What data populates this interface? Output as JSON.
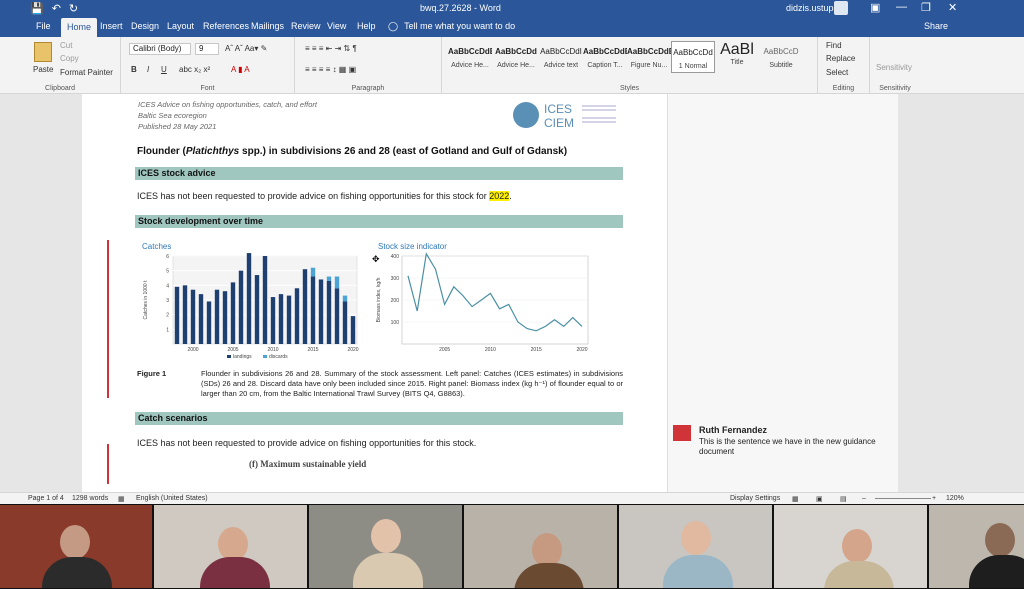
{
  "window": {
    "title": "bwq.27.2628 - Word",
    "user": "didzis.ustups",
    "share": "Share"
  },
  "tabs": [
    "File",
    "Home",
    "Insert",
    "Design",
    "Layout",
    "References",
    "Mailings",
    "Review",
    "View",
    "Help"
  ],
  "tell_me": "Tell me what you want to do",
  "ribbon": {
    "clipboard": {
      "paste": "Paste",
      "cut": "Cut",
      "copy": "Copy",
      "format_painter": "Format Painter",
      "label": "Clipboard"
    },
    "font": {
      "name": "Calibri (Body)",
      "size": "9",
      "label": "Font"
    },
    "paragraph": {
      "label": "Paragraph"
    },
    "styles": {
      "label": "Styles",
      "items": [
        {
          "sample": "AaBbCcDdEe",
          "name": "Advice He..."
        },
        {
          "sample": "AaBbCcDd",
          "name": "Advice He..."
        },
        {
          "sample": "AaBbCcDdI",
          "name": "Advice text"
        },
        {
          "sample": "AaBbCcDdEe",
          "name": "Caption T..."
        },
        {
          "sample": "AaBbCcDdEe",
          "name": "Figure Nu..."
        },
        {
          "sample": "AaBbCcDd",
          "name": "1 Normal"
        },
        {
          "sample": "AaBl",
          "name": "Title"
        },
        {
          "sample": "AaBbCcD",
          "name": "Subtitle"
        }
      ]
    },
    "editing": {
      "find": "Find",
      "replace": "Replace",
      "select": "Select",
      "label": "Editing"
    },
    "sensitivity": {
      "label": "Sensitivity",
      "button": "Sensitivity"
    }
  },
  "document": {
    "header_lines": [
      "ICES Advice on fishing opportunities, catch, and effort",
      "Baltic Sea ecoregion",
      "Published 28 May 2021"
    ],
    "logo": {
      "line1": "ICES",
      "line2": "CIEM"
    },
    "title_part1": "Flounder (",
    "title_italic": "Platichthys",
    "title_part2": " spp.) in subdivisions 26 and 28 (east of Gotland and Gulf of Gdansk)",
    "sec1": "ICES stock advice",
    "para1_prefix": "ICES has not been requested to provide advice on fishing opportunities for this stock for ",
    "para1_highlight": "2022",
    "para1_suffix": ".",
    "sec2": "Stock development over time",
    "chart_left_title": "Catches",
    "chart_right_title": "Stock size indicator",
    "fig_label": "Figure 1",
    "fig_text": "Flounder in subdivisions 26 and 28. Summary of the stock assessment. Left panel: Catches (ICES estimates) in subdivisions (SDs) 26 and 28. Discard data have only been included since 2015. Right panel: Biomass index (kg h⁻¹) of flounder equal to or larger than 20 cm, from the Baltic International Trawl Survey (BITS Q4, G8863).",
    "sec3": "Catch scenarios",
    "para2": "ICES has not been requested to provide advice on fishing opportunities for this stock.",
    "msy": "(f) Maximum sustainable yield"
  },
  "comment": {
    "author": "Ruth Fernandez",
    "text": "This is the sentence we have in the new guidance document"
  },
  "status": {
    "page": "Page 1 of 4",
    "words": "1298 words",
    "language": "English (United States)",
    "display": "Display Settings",
    "zoom": "120%"
  },
  "chart_data": [
    {
      "type": "bar",
      "title": "Catches",
      "ylabel": "Catches in 1000 t",
      "categories": [
        1998,
        1999,
        2000,
        2001,
        2002,
        2003,
        2004,
        2005,
        2006,
        2007,
        2008,
        2009,
        2010,
        2011,
        2012,
        2013,
        2014,
        2015,
        2016,
        2017,
        2018,
        2019,
        2020
      ],
      "x_ticks": [
        "2000",
        "2005",
        "2010",
        "2015",
        "2020"
      ],
      "ylim": [
        0,
        6
      ],
      "series": [
        {
          "name": "landings",
          "color": "#1f3f6e",
          "values": [
            3.9,
            4.0,
            3.7,
            3.4,
            2.9,
            3.7,
            3.6,
            4.2,
            5.0,
            6.2,
            4.7,
            6.0,
            3.2,
            3.4,
            3.3,
            3.8,
            5.1,
            4.6,
            4.4,
            4.3,
            3.8,
            2.9,
            1.9
          ]
        },
        {
          "name": "discards",
          "color": "#4ba3d6",
          "values": [
            0,
            0,
            0,
            0,
            0,
            0,
            0,
            0,
            0,
            0,
            0,
            0,
            0,
            0,
            0,
            0,
            0,
            0.6,
            0,
            0.3,
            0.8,
            0.4,
            0
          ]
        }
      ],
      "legend": "bottom"
    },
    {
      "type": "line",
      "title": "Stock size indicator",
      "ylabel": "Biomass index, kg/h",
      "x": [
        2001,
        2002,
        2003,
        2004,
        2005,
        2006,
        2007,
        2008,
        2009,
        2010,
        2011,
        2012,
        2013,
        2014,
        2015,
        2016,
        2017,
        2018,
        2019,
        2020
      ],
      "x_ticks": [
        "2005",
        "2010",
        "2015",
        "2020"
      ],
      "y": [
        310,
        150,
        410,
        340,
        180,
        260,
        220,
        170,
        200,
        230,
        160,
        180,
        100,
        70,
        60,
        80,
        110,
        80,
        120,
        80
      ],
      "ylim": [
        0,
        400
      ],
      "y_ticks": [
        "100",
        "200",
        "300",
        "400"
      ],
      "color": "#4a90a4"
    }
  ],
  "participants": [
    "participant-1",
    "participant-2",
    "participant-3",
    "participant-4",
    "participant-5",
    "participant-6",
    "participant-7"
  ]
}
